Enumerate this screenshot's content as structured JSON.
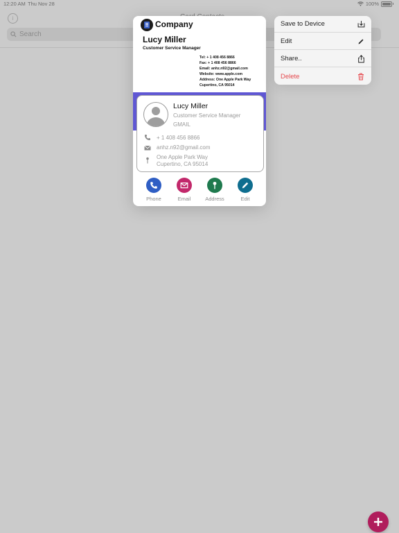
{
  "status_bar": {
    "time": "12:20 AM",
    "date": "Thu Nov 28",
    "battery": "100%"
  },
  "nav": {
    "title": "Card Contacts"
  },
  "search": {
    "placeholder": "Search"
  },
  "business_card": {
    "company": "Company",
    "name": "Lucy Miller",
    "title": "Customer Service Manager",
    "details": [
      "Tel:   + 1 408 456 8866",
      "Fax:  + 1 408 456 8866",
      "Email: anhz.n92@gmail.com",
      "Website: www.apple.com",
      "Address: One Apple Park Way",
      "Cupertino, CA 95014"
    ],
    "accent_color": "#5f57d3"
  },
  "contact": {
    "name": "Lucy Miller",
    "title": "Customer Service Manager",
    "company": "GMAIL",
    "phone": "+ 1 408 456 8866",
    "email": "anhz.n92@gmail.com",
    "address_line1": "One Apple Park Way",
    "address_line2": "Cupertino, CA 95014"
  },
  "actions": [
    {
      "label": "Phone",
      "icon": "phone-icon",
      "color": "#2f5ec4"
    },
    {
      "label": "Email",
      "icon": "mail-icon",
      "color": "#c2286b"
    },
    {
      "label": "Address",
      "icon": "pin-icon",
      "color": "#1f7a4e"
    },
    {
      "label": "Edit",
      "icon": "pencil-icon",
      "color": "#0f6e8f"
    }
  ],
  "menu": {
    "items": [
      {
        "label": "Save to Device",
        "icon": "download-icon"
      },
      {
        "label": "Edit",
        "icon": "pencil-icon"
      },
      {
        "label": "Share..",
        "icon": "share-icon"
      },
      {
        "label": "Delete",
        "icon": "trash-icon",
        "color": "#e5484d"
      }
    ]
  },
  "fab": {
    "icon": "plus-icon",
    "color": "#b01d5c"
  }
}
